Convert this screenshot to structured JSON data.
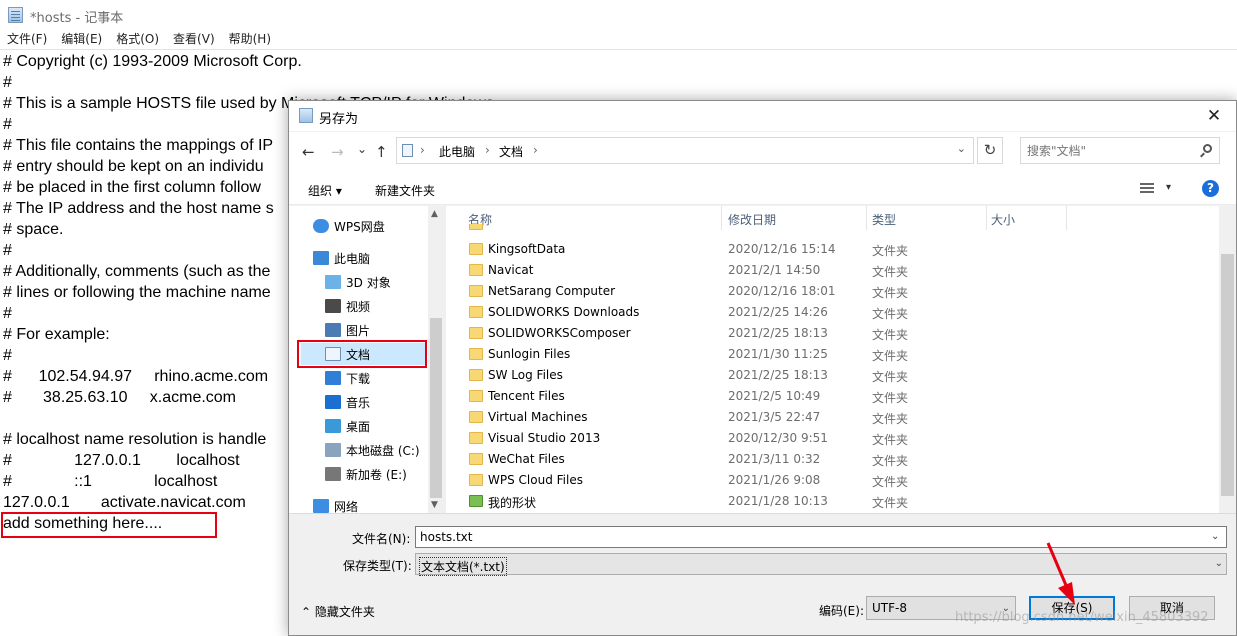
{
  "notepad": {
    "title": "*hosts - 记事本",
    "menu": [
      "文件(F)",
      "编辑(E)",
      "格式(O)",
      "查看(V)",
      "帮助(H)"
    ],
    "lines": [
      "# Copyright (c) 1993-2009 Microsoft Corp.",
      "#",
      "# This is a sample HOSTS file used by Microsoft TCP/IP for Windows.",
      "#",
      "# This file contains the mappings of IP",
      "# entry should be kept on an individu",
      "# be placed in the first column follow",
      "# The IP address and the host name s",
      "# space.",
      "#",
      "# Additionally, comments (such as the",
      "# lines or following the machine name",
      "#",
      "# For example:",
      "#",
      "#      102.54.94.97     rhino.acme.com",
      "#       38.25.63.10     x.acme.com",
      "",
      "# localhost name resolution is handle",
      "#              127.0.0.1        localhost",
      "#              ::1              localhost",
      "127.0.0.1       activate.navicat.com",
      "add something here...."
    ]
  },
  "dialog": {
    "title": "另存为",
    "close": "✕",
    "nav": {
      "back": "←",
      "forward": "→",
      "recent": "⌄",
      "up": "↑",
      "refresh": "↻",
      "sep": "›",
      "address_dropdown": "⌄"
    },
    "address": [
      "此电脑",
      "文档"
    ],
    "search_placeholder": "搜索\"文档\"",
    "toolbar": {
      "organize": "组织 ▾",
      "new_folder": "新建文件夹",
      "view_dropdown": "▾",
      "help": "?"
    },
    "nav_items": [
      {
        "label": "WPS网盘",
        "icon": "cloud-icon"
      },
      {
        "label": "此电脑",
        "icon": "computer-icon"
      },
      {
        "label": "3D 对象",
        "icon": "cube-icon"
      },
      {
        "label": "视频",
        "icon": "video-icon"
      },
      {
        "label": "图片",
        "icon": "picture-icon"
      },
      {
        "label": "文档",
        "icon": "document-icon"
      },
      {
        "label": "下载",
        "icon": "download-icon"
      },
      {
        "label": "音乐",
        "icon": "music-icon"
      },
      {
        "label": "桌面",
        "icon": "desktop-icon"
      },
      {
        "label": "本地磁盘 (C:)",
        "icon": "disk-icon"
      },
      {
        "label": "新加卷 (E:)",
        "icon": "drive-icon"
      },
      {
        "label": "网络",
        "icon": "network-icon"
      }
    ],
    "columns": {
      "name": "名称",
      "date": "修改日期",
      "type": "类型",
      "size": "大小"
    },
    "files": [
      {
        "name": "KingsoftData",
        "date": "2020/12/16 15:14",
        "type": "文件夹"
      },
      {
        "name": "Navicat",
        "date": "2021/2/1 14:50",
        "type": "文件夹"
      },
      {
        "name": "NetSarang Computer",
        "date": "2020/12/16 18:01",
        "type": "文件夹"
      },
      {
        "name": "SOLIDWORKS Downloads",
        "date": "2021/2/25 14:26",
        "type": "文件夹"
      },
      {
        "name": "SOLIDWORKSComposer",
        "date": "2021/2/25 18:13",
        "type": "文件夹"
      },
      {
        "name": "Sunlogin Files",
        "date": "2021/1/30 11:25",
        "type": "文件夹"
      },
      {
        "name": "SW Log Files",
        "date": "2021/2/25 18:13",
        "type": "文件夹"
      },
      {
        "name": "Tencent Files",
        "date": "2021/2/5 10:49",
        "type": "文件夹"
      },
      {
        "name": "Virtual Machines",
        "date": "2021/3/5 22:47",
        "type": "文件夹"
      },
      {
        "name": "Visual Studio 2013",
        "date": "2020/12/30 9:51",
        "type": "文件夹"
      },
      {
        "name": "WeChat Files",
        "date": "2021/3/11 0:32",
        "type": "文件夹"
      },
      {
        "name": "WPS Cloud Files",
        "date": "2021/1/26 9:08",
        "type": "文件夹"
      },
      {
        "name": "我的形状",
        "date": "2021/1/28 10:13",
        "type": "文件夹"
      }
    ],
    "filename_label": "文件名(N):",
    "filename_value": "hosts.txt",
    "filetype_label": "保存类型(T):",
    "filetype_value": "文本文档(*.txt)",
    "hide_folders": "⌃ 隐藏文件夹",
    "encoding_label": "编码(E):",
    "encoding_value": "UTF-8",
    "dropdown_glyph": "⌄",
    "save": "保存(S)",
    "cancel": "取消"
  },
  "watermark": "https://blog.csdn.net/weixin_45803392",
  "colors": {
    "highlight": "#e60012",
    "accent": "#0078d7",
    "folder": "#f8d775",
    "selected_nav": "#cce8ff"
  }
}
